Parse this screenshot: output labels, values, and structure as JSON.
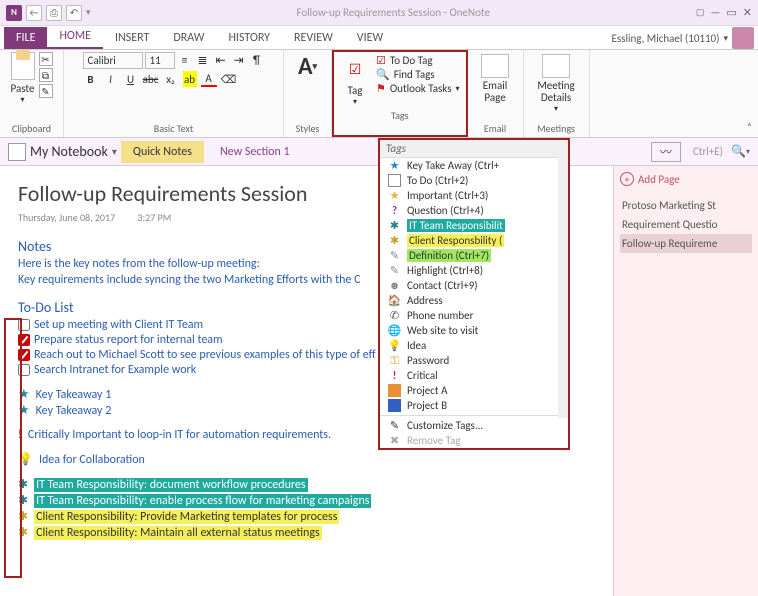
{
  "window_title": "Follow-up Requirements Session - OneNote",
  "user_name": "Essling, Michael (10110)",
  "tabs": {
    "file": "FILE",
    "home": "HOME",
    "insert": "INSERT",
    "draw": "DRAW",
    "history": "HISTORY",
    "review": "REVIEW",
    "view": "VIEW"
  },
  "ribbon": {
    "paste": "Paste",
    "clipboard": "Clipboard",
    "font_name": "Calibri",
    "font_size": "11",
    "basic_text": "Basic Text",
    "styles": "Styles",
    "tag_label": "Tag",
    "todo_tag": "To Do Tag",
    "find_tags": "Find Tags",
    "outlook_tasks": "Outlook Tasks",
    "tags_group": "Tags",
    "email_page": "Email Page",
    "email_group": "Email",
    "meeting_details": "Meeting Details",
    "meetings_group": "Meetings"
  },
  "notebook": {
    "label": "My Notebook",
    "section_active": "Quick Notes",
    "section_new": "New Section 1",
    "search_placeholder": "Ctrl+E)"
  },
  "pages": {
    "add": "Add Page",
    "p1": "Protoso Marketing St",
    "p2": "Requirement Questio",
    "p3": "Follow-up Requireme"
  },
  "page": {
    "title": "Follow-up Requirements Session",
    "date": "Thursday, June 08, 2017",
    "time": "3:27 PM",
    "notes_h": "Notes",
    "notes_1": "Here is the key notes from the follow-up meeting:",
    "notes_2": "Key requirements include syncing the two Marketing Efforts with the C",
    "todo_h": "To-Do List",
    "todo_1": "Set up meeting with Client IT Team",
    "todo_2": "Prepare status report for internal team",
    "todo_3": "Reach out to Michael Scott to see previous examples of this type of eff",
    "todo_4": "Search Intranet for Example work",
    "kt1": "Key Takeaway 1",
    "kt2": "Key Takeaway  2",
    "crit": "Critically Important to loop-in IT for automation requirements.",
    "idea": "Idea for Collaboration",
    "it1": "IT Team Responsibility: document workflow procedures",
    "it2": "IT Team Responsibility: enable process flow for marketing campaigns",
    "cl1": "Client Responsibility: Provide Marketing templates for process",
    "cl2": "Client Responsibility: Maintain all external status meetings"
  },
  "tags_menu": {
    "hdr": "Tags",
    "items": [
      {
        "k": "kt",
        "lbl": "Key Take Away (Ctrl+"
      },
      {
        "k": "todo",
        "lbl": "To Do (Ctrl+2)"
      },
      {
        "k": "imp",
        "lbl": "Important (Ctrl+3)"
      },
      {
        "k": "q",
        "lbl": "Question (Ctrl+4)"
      },
      {
        "k": "it",
        "lbl": "IT Team Responsibilit"
      },
      {
        "k": "cl",
        "lbl": "Client Responsbility ("
      },
      {
        "k": "def",
        "lbl": "Definition (Ctrl+7)"
      },
      {
        "k": "hl",
        "lbl": "Highlight (Ctrl+8)"
      },
      {
        "k": "ct",
        "lbl": "Contact (Ctrl+9)"
      },
      {
        "k": "addr",
        "lbl": "Address"
      },
      {
        "k": "ph",
        "lbl": "Phone number"
      },
      {
        "k": "web",
        "lbl": "Web site to visit"
      },
      {
        "k": "idea",
        "lbl": "Idea"
      },
      {
        "k": "pw",
        "lbl": "Password"
      },
      {
        "k": "crit",
        "lbl": "Critical"
      },
      {
        "k": "pa",
        "lbl": "Project A"
      },
      {
        "k": "pb",
        "lbl": "Project B"
      }
    ],
    "customize": "Customize Tags...",
    "remove": "Remove Tag"
  }
}
